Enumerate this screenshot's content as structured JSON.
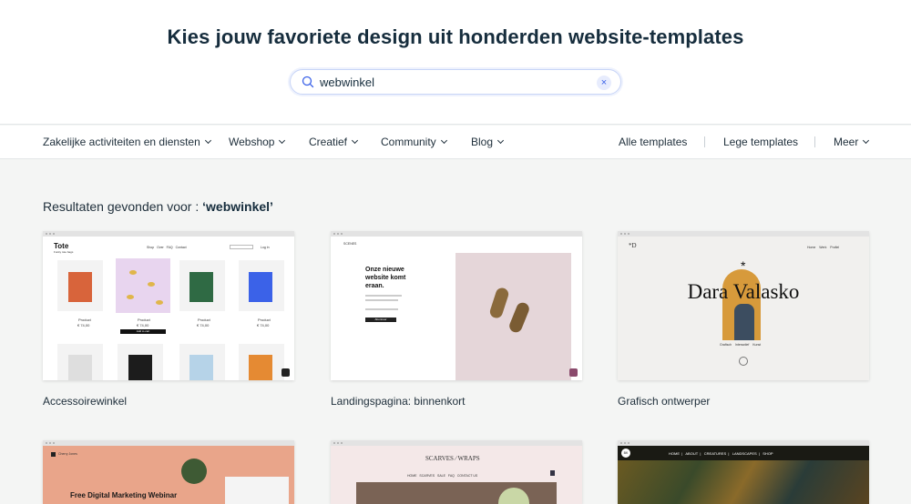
{
  "hero": {
    "title": "Kies jouw favoriete design uit honderden website-templates",
    "search": {
      "value": "webwinkel",
      "clear_icon": "×"
    }
  },
  "nav": {
    "categories": [
      {
        "label": "Zakelijke activiteiten en diensten"
      },
      {
        "label": "Webshop"
      },
      {
        "label": "Creatief"
      },
      {
        "label": "Community"
      },
      {
        "label": "Blog"
      }
    ],
    "all_templates": "Alle templates",
    "blank_templates": "Lege templates",
    "more": "Meer"
  },
  "results": {
    "prefix": "Resultaten gevonden voor : ",
    "query": "‘webwinkel’"
  },
  "templates": [
    {
      "name": "Accessoirewinkel",
      "preview": {
        "brand": "Tote",
        "tagline": "Funky tote bags",
        "nav": [
          "Shop",
          "Over",
          "FAQ",
          "Contact"
        ],
        "login": "Log in",
        "products": [
          "Product",
          "Product",
          "Product",
          "Product"
        ],
        "prices": [
          "€ 74,00",
          "€ 74,00",
          "€ 74,00",
          "€ 74,00"
        ],
        "cart_button": "Add to cart"
      }
    },
    {
      "name": "Landingspagina: binnenkort",
      "preview": {
        "brand": "SCENES",
        "headline": "Onze nieuwe website komt eraan.",
        "button": "Abonneer"
      }
    },
    {
      "name": "Grafisch ontwerper",
      "preview": {
        "logo": "*D",
        "nav": [
          "Home",
          "Werk",
          "Profiel"
        ],
        "hero_name": "Dara Valasko",
        "tags": [
          "Grafisch",
          "Interactief",
          "Kunst"
        ]
      }
    },
    {
      "name": "",
      "preview": {
        "brand": "Cherry Jones",
        "headline": "Free Digital Marketing Webinar"
      }
    },
    {
      "name": "",
      "preview": {
        "brand_left": "SCARVES",
        "brand_right": "WRAPS",
        "nav": [
          "HOME",
          "SCARVES",
          "SALE",
          "FAQ",
          "CONTACT US"
        ]
      }
    },
    {
      "name": "",
      "preview": {
        "logo": "BK",
        "nav": [
          "HOME",
          "ABOUT",
          "CREATURES",
          "LANDSCAPES",
          "SHOP"
        ]
      }
    }
  ],
  "colors": {
    "page_bg": "#f4f5f4",
    "accent": "#3b62e8",
    "peach": "#e9a58a",
    "dark_art": "#2a2a20"
  }
}
